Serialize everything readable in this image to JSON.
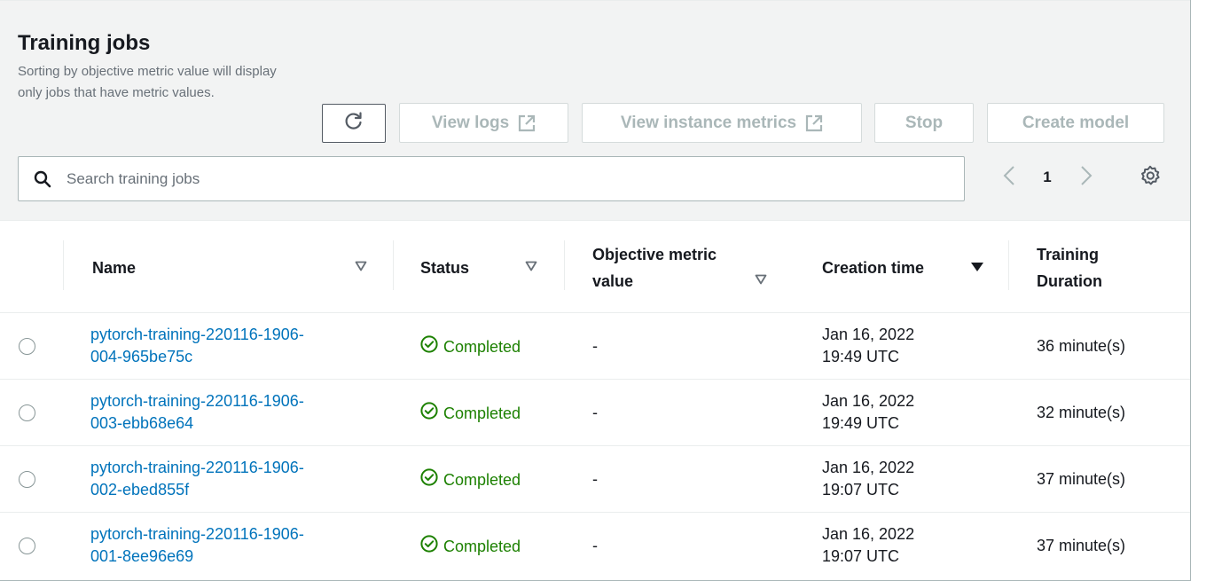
{
  "title": "Training jobs",
  "description": "Sorting by objective metric value will display only jobs that have metric values.",
  "toolbar": {
    "refresh_icon": "refresh-icon",
    "view_logs": "View logs",
    "view_instance_metrics": "View instance metrics",
    "stop": "Stop",
    "create_model": "Create model",
    "external_icon": "external-link-icon"
  },
  "search": {
    "placeholder": "Search training jobs",
    "value": ""
  },
  "pagination": {
    "current_page": "1"
  },
  "columns": {
    "name": "Name",
    "status": "Status",
    "objective_metric_value": "Objective metric value",
    "creation_time": "Creation time",
    "training_duration": "Training Duration"
  },
  "rows": [
    {
      "name_line1": "pytorch-training-220116-1906-",
      "name_line2": "004-965be75c",
      "status": "Completed",
      "metric": "-",
      "created_date": "Jan 16, 2022",
      "created_time": "19:49 UTC",
      "duration": "36 minute(s)"
    },
    {
      "name_line1": "pytorch-training-220116-1906-",
      "name_line2": "003-ebb68e64",
      "status": "Completed",
      "metric": "-",
      "created_date": "Jan 16, 2022",
      "created_time": "19:49 UTC",
      "duration": "32 minute(s)"
    },
    {
      "name_line1": "pytorch-training-220116-1906-",
      "name_line2": "002-ebed855f",
      "status": "Completed",
      "metric": "-",
      "created_date": "Jan 16, 2022",
      "created_time": "19:07 UTC",
      "duration": "37 minute(s)"
    },
    {
      "name_line1": "pytorch-training-220116-1906-",
      "name_line2": "001-8ee96e69",
      "status": "Completed",
      "metric": "-",
      "created_date": "Jan 16, 2022",
      "created_time": "19:07 UTC",
      "duration": "37 minute(s)"
    }
  ],
  "colors": {
    "link": "#0073bb",
    "success": "#1d8102",
    "disabled": "#aab7b8",
    "header_bg": "#f2f3f3"
  }
}
